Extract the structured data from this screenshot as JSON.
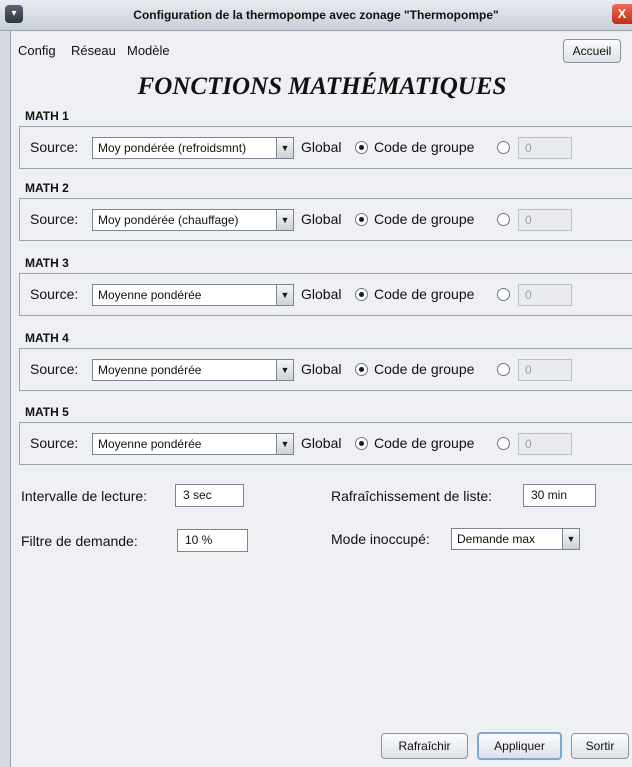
{
  "window": {
    "title": "Configuration de la thermopompe avec zonage \"Thermopompe\"",
    "close_glyph": "X",
    "menu_glyph": "▾"
  },
  "menu": {
    "items": [
      "Config",
      "Réseau",
      "Modèle"
    ],
    "home_button": "Accueil"
  },
  "page_title": "FONCTIONS MATHÉMATIQUES",
  "sections": [
    {
      "label": "MATH 1",
      "source_label": "Source:",
      "source_value": "Moy pondérée (refroidsmnt)",
      "global_label": "Global",
      "global_selected": true,
      "group_label": "Code de groupe",
      "group_code": "0"
    },
    {
      "label": "MATH 2",
      "source_label": "Source:",
      "source_value": "Moy pondérée (chauffage)",
      "global_label": "Global",
      "global_selected": true,
      "group_label": "Code de groupe",
      "group_code": "0"
    },
    {
      "label": "MATH 3",
      "source_label": "Source:",
      "source_value": "Moyenne pondérée",
      "global_label": "Global",
      "global_selected": true,
      "group_label": "Code de groupe",
      "group_code": "0"
    },
    {
      "label": "MATH 4",
      "source_label": "Source:",
      "source_value": "Moyenne pondérée",
      "global_label": "Global",
      "global_selected": true,
      "group_label": "Code de groupe",
      "group_code": "0"
    },
    {
      "label": "MATH 5",
      "source_label": "Source:",
      "source_value": "Moyenne pondérée",
      "global_label": "Global",
      "global_selected": true,
      "group_label": "Code de groupe",
      "group_code": "0"
    }
  ],
  "settings": {
    "read_interval_label": "Intervalle de lecture:",
    "read_interval_value": "3 sec",
    "list_refresh_label": "Rafraîchissement de liste:",
    "list_refresh_value": "30 min",
    "demand_filter_label": "Filtre de demande:",
    "demand_filter_value": "10 %",
    "unoccupied_mode_label": "Mode inoccupé:",
    "unoccupied_mode_value": "Demande max"
  },
  "footer": {
    "refresh_button": "Rafraîchir",
    "apply_button": "Appliquer",
    "exit_button": "Sortir"
  },
  "colors": {
    "window_bg": "#eef0f4",
    "titlebar": "#d4d8df",
    "close_button": "#d9402a",
    "apply_focus_ring": "#7ea6d6"
  }
}
